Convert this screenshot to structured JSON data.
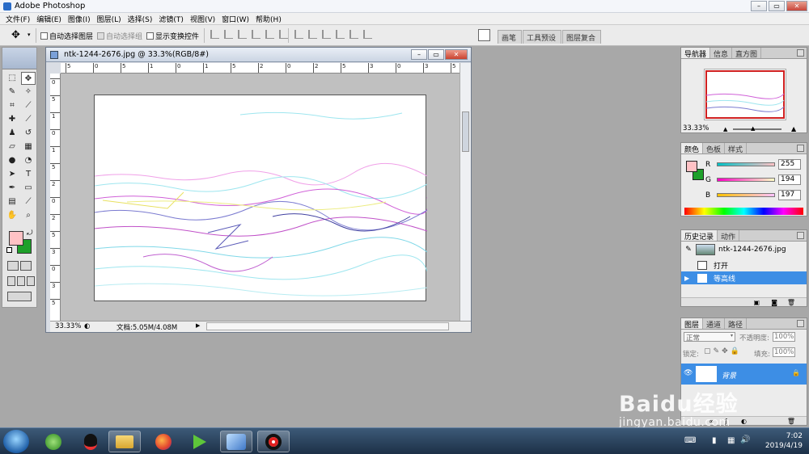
{
  "app": {
    "title": "Adobe Photoshop"
  },
  "menu": [
    "文件(F)",
    "编辑(E)",
    "图像(I)",
    "图层(L)",
    "选择(S)",
    "滤镜(T)",
    "视图(V)",
    "窗口(W)",
    "帮助(H)"
  ],
  "options": {
    "auto_select_layer": "自动选择图层",
    "auto_select_group": "自动选择组",
    "show_transform": "显示变换控件"
  },
  "palette_well": [
    "画笔",
    "工具预设",
    "图层复合"
  ],
  "document": {
    "title": "ntk-1244-2676.jpg @ 33.3%(RGB/8#)",
    "zoom": "33.33%",
    "doc_size": "文档:5.05M/4.08M",
    "ruler_top": [
      "5",
      "0",
      "5",
      "1",
      "0",
      "1",
      "5",
      "2",
      "0",
      "2",
      "5",
      "3",
      "0",
      "3",
      "5"
    ],
    "ruler_left": [
      "0",
      "5",
      "1",
      "0",
      "1",
      "5",
      "2",
      "0",
      "2",
      "5",
      "3",
      "0",
      "3",
      "5"
    ]
  },
  "navigator": {
    "tabs": [
      "导航器",
      "信息",
      "直方图"
    ],
    "zoom": "33.33%"
  },
  "color": {
    "tabs": [
      "颜色",
      "色板",
      "样式"
    ],
    "r_label": "R",
    "g_label": "G",
    "b_label": "B",
    "r": "255",
    "g": "194",
    "b": "197",
    "foreground": "#ffc2c5",
    "background": "#1ea02a"
  },
  "history": {
    "tabs": [
      "历史记录",
      "动作"
    ],
    "snapshot": "ntk-1244-2676.jpg",
    "items": [
      "打开",
      "等高线"
    ]
  },
  "layers": {
    "tabs": [
      "图层",
      "通道",
      "路径"
    ],
    "blend_mode": "正常",
    "opacity_label": "不透明度:",
    "opacity": "100%",
    "lock_label": "锁定:",
    "fill_label": "填充:",
    "fill": "100%",
    "layer_name": "背景"
  },
  "taskbar": {
    "time": "7:02",
    "date": "2019/4/19"
  },
  "watermark": {
    "logo": "Baidu经验",
    "url": "jingyan.baidu.com"
  }
}
